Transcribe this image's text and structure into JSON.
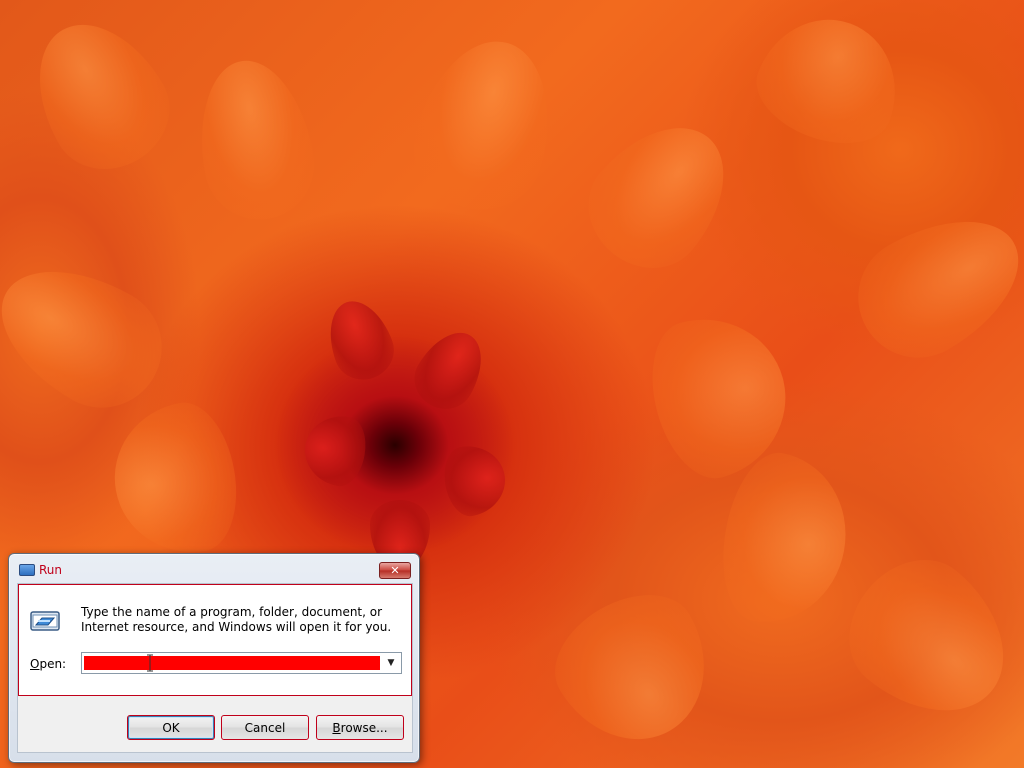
{
  "dialog": {
    "title": "Run",
    "close_symbol": "✕",
    "description": "Type the name of a program, folder, document, or Internet resource, and Windows will open it for you.",
    "open_label_accel": "O",
    "open_label_rest": "pen:",
    "open_value": "",
    "dropdown_symbol": "▼",
    "buttons": {
      "ok": "OK",
      "cancel": "Cancel",
      "browse_accel": "B",
      "browse_rest": "rowse..."
    }
  },
  "icons": {
    "title_icon": "run-window-icon",
    "program_icon": "run-program-icon"
  },
  "colors": {
    "highlight": "#ff0000",
    "title_text": "#c0001a"
  }
}
